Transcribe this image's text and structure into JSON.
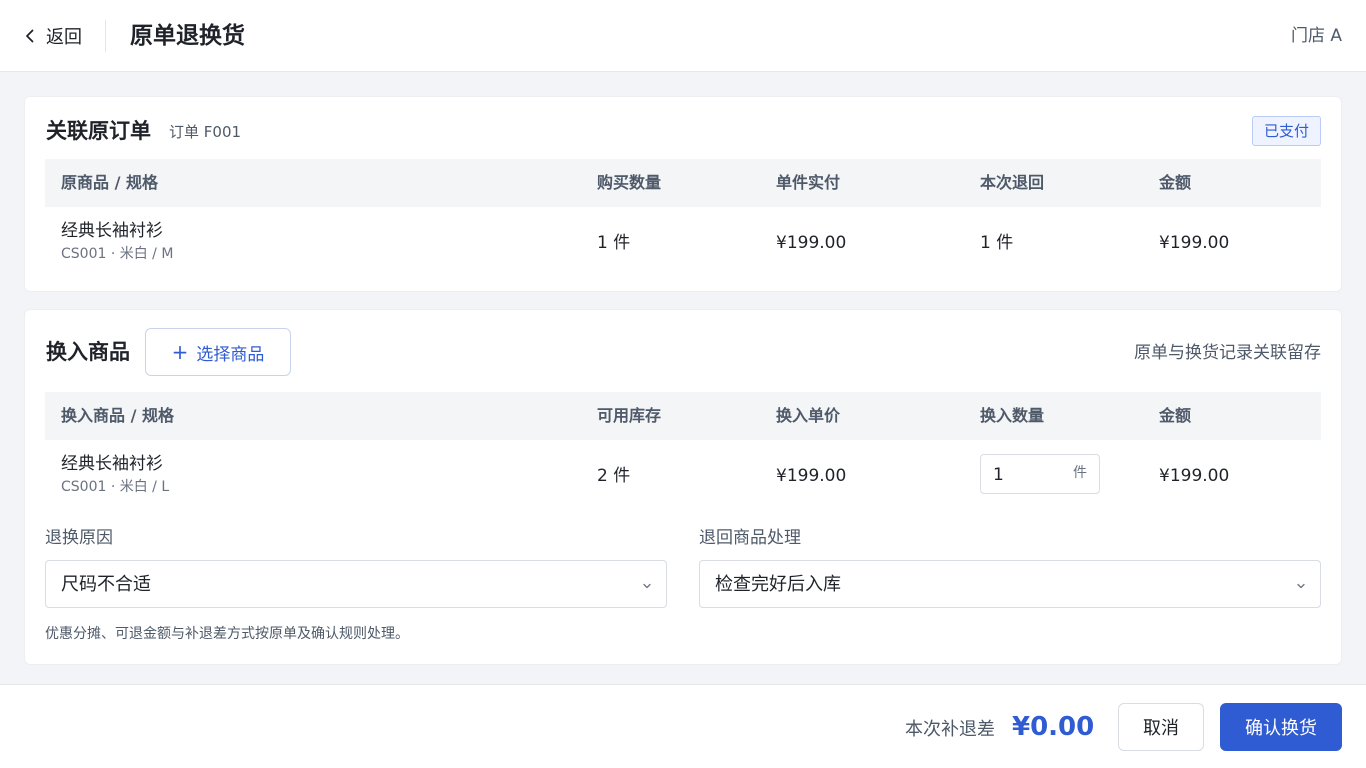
{
  "header": {
    "back_label": "返回",
    "title": "原单退换货",
    "store": "门店 A"
  },
  "original_order": {
    "title": "关联原订单",
    "order_ref": "订单 F001",
    "status": "已支付",
    "columns": [
      "原商品 / 规格",
      "购买数量",
      "单件实付",
      "本次退回",
      "金额"
    ],
    "rows": [
      {
        "name": "经典长袖衬衫",
        "sku": "CS001 · 米白 / M",
        "purchase_qty": "1 件",
        "unit_paid": "¥199.00",
        "return_qty": "1 件",
        "amount": "¥199.00"
      }
    ]
  },
  "exchange": {
    "title": "换入商品",
    "select_button": "选择商品",
    "hint": "原单与换货记录关联留存",
    "columns": [
      "换入商品 / 规格",
      "可用库存",
      "换入单价",
      "换入数量",
      "金额"
    ],
    "rows": [
      {
        "name": "经典长袖衬衫",
        "sku": "CS001 · 米白 / L",
        "stock": "2 件",
        "unit_price": "¥199.00",
        "qty": "1",
        "qty_unit": "件",
        "amount": "¥199.00"
      }
    ],
    "reason_label": "退换原因",
    "reason_value": "尺码不合适",
    "handling_label": "退回商品处理",
    "handling_value": "检查完好后入库",
    "footnote": "优惠分摊、可退金额与补退差方式按原单及确认规则处理。"
  },
  "footer": {
    "diff_label": "本次补退差",
    "diff_amount": "¥0.00",
    "cancel": "取消",
    "confirm": "确认换货"
  },
  "colors": {
    "accent": "#2f5bd3",
    "background": "#f3f4f7"
  }
}
